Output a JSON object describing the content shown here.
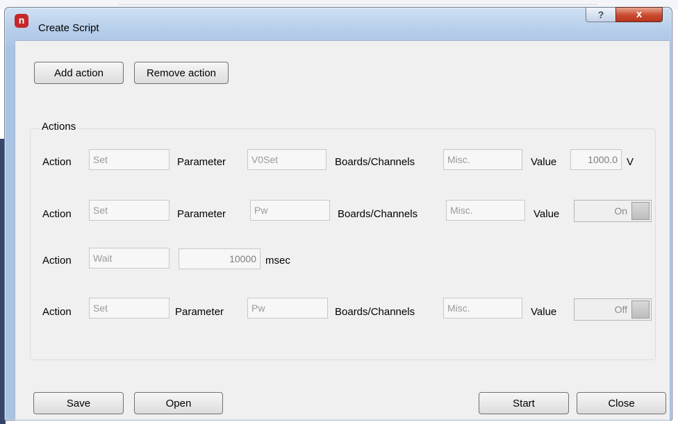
{
  "window": {
    "title": "Create Script",
    "icon": "n-logo-icon",
    "help_label": "?",
    "close_label": "x"
  },
  "toolbar": {
    "add_action": "Add action",
    "remove_action": "Remove action"
  },
  "actions_group": {
    "title": "Actions"
  },
  "rows": [
    {
      "action_label": "Action",
      "action_value": "Set",
      "parameter_label": "Parameter",
      "parameter_value": "V0Set",
      "boards_label": "Boards/Channels",
      "boards_value": "Misc.",
      "value_label": "Value",
      "value": "1000.0",
      "unit": "V"
    },
    {
      "action_label": "Action",
      "action_value": "Set",
      "parameter_label": "Parameter",
      "parameter_value": "Pw",
      "boards_label": "Boards/Channels",
      "boards_value": "Misc.",
      "value_label": "Value",
      "toggle": "On"
    },
    {
      "action_label": "Action",
      "action_value": "Wait",
      "wait_value": "10000",
      "wait_unit": "msec"
    },
    {
      "action_label": "Action",
      "action_value": "Set",
      "parameter_label": "Parameter",
      "parameter_value": "Pw",
      "boards_label": "Boards/Channels",
      "boards_value": "Misc.",
      "value_label": "Value",
      "toggle": "Off"
    }
  ],
  "footer": {
    "save": "Save",
    "open": "Open",
    "start": "Start",
    "close": "Close"
  }
}
